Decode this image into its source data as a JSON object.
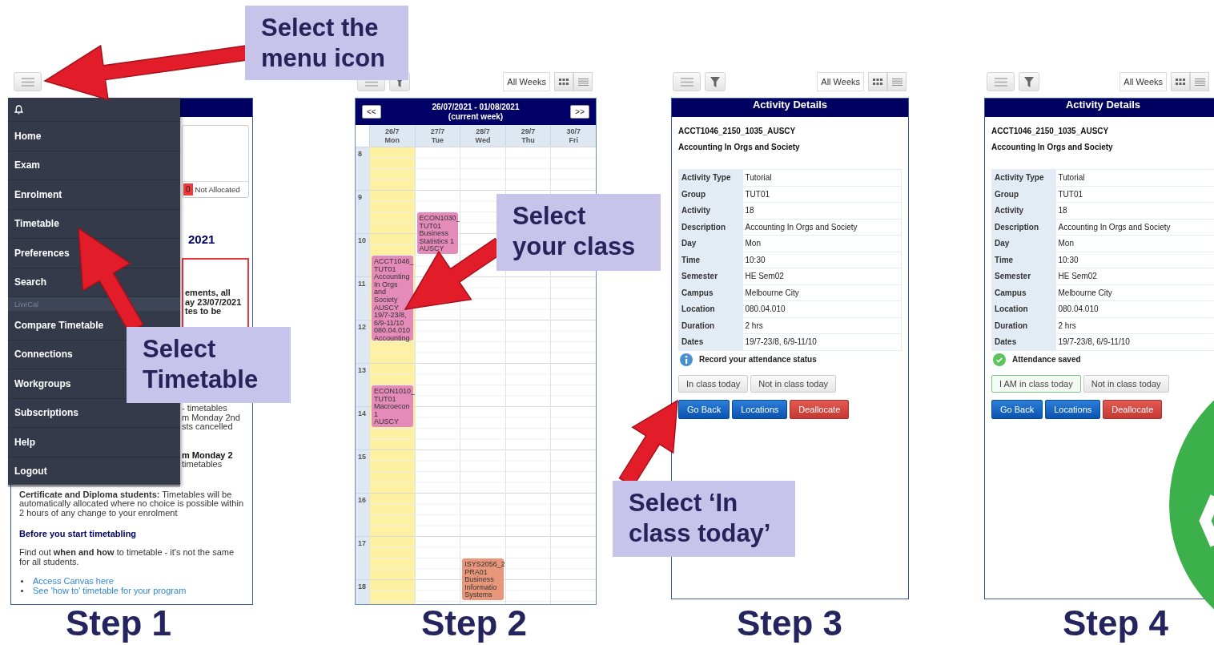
{
  "callouts": [
    {
      "text": "Select the\nmenu icon"
    },
    {
      "text": "Select\nTimetable"
    },
    {
      "text": "Select\nyour class"
    },
    {
      "text": "Select ‘In\nclass today’"
    }
  ],
  "step_labels": [
    "Step 1",
    "Step 2",
    "Step 3",
    "Step 4"
  ],
  "step_1": {
    "menu": [
      {
        "kind": "bell"
      },
      {
        "kind": "item",
        "label": "Home"
      },
      {
        "kind": "item",
        "label": "Exam"
      },
      {
        "kind": "item",
        "label": "Enrolment"
      },
      {
        "kind": "item",
        "label": "Timetable"
      },
      {
        "kind": "item",
        "label": "Preferences"
      },
      {
        "kind": "item",
        "label": "Search"
      },
      {
        "kind": "section",
        "label": "LiveCal"
      },
      {
        "kind": "item",
        "label": "Compare Timetable"
      },
      {
        "kind": "item",
        "label": "Connections"
      },
      {
        "kind": "item",
        "label": "Workgroups"
      },
      {
        "kind": "item",
        "label": "Subscriptions"
      },
      {
        "kind": "item",
        "label": "Help"
      },
      {
        "kind": "item",
        "label": "Logout"
      }
    ],
    "enrolment_card": {
      "badge": "0",
      "label": "Not Allocated"
    },
    "heading_fragment": "2021",
    "notice_fragments": [
      "ements, all",
      "ay 23/07/2021",
      "tes to be"
    ],
    "text_fragments": [
      {
        "bold": false,
        "lines": [
          "- timetables",
          "m Monday 2nd",
          "sts cancelled"
        ]
      },
      {
        "bold": true,
        "lines": [
          "m Monday 2"
        ]
      },
      {
        "bold": false,
        "lines": [
          "timetables"
        ]
      }
    ],
    "certificate_note": "**Certificate and Diploma students:** Timetables will be automatically allocated where no choice is possible within 2 hours of any change to your enrolment",
    "section_heading": "Before you start timetabling",
    "intro": "Find out **when and how** to timetable - it's not the same for all students.",
    "links": [
      "Access Canvas here",
      "See 'how to' timetable for your program"
    ]
  },
  "step_2": {
    "toolbar": {
      "all_weeks": "All Weeks"
    },
    "calendar": {
      "prev": "<<",
      "next": ">>",
      "range": "26/07/2021 - 01/08/2021",
      "note": "(current week)",
      "hours": [
        "8",
        "9",
        "10",
        "11",
        "12",
        "13",
        "14",
        "15",
        "16",
        "17",
        "18"
      ],
      "days": [
        {
          "date": "26/7",
          "day": "Mon",
          "selected": true,
          "events": [
            {
              "color": "#e58bb9",
              "text": "ACCT1046_\nTUT01\nAccounting\nIn Orgs\nand\nSociety\nAUSCY\n19/7-23/8,\n6/9-11/10\n080.04.010\nAccounting"
            },
            {
              "color": "#e58bb9",
              "text": "ECON1010_\nTUT01\nMacroecon\n1\nAUSCY"
            }
          ]
        },
        {
          "date": "27/7",
          "day": "Tue",
          "selected": false,
          "events": [
            {
              "color": "#e58bb9",
              "text": "ECON1030_\nTUT01\nBusiness\nStatistics 1\nAUSCY"
            }
          ]
        },
        {
          "date": "28/7",
          "day": "Wed",
          "selected": false,
          "events": [
            {
              "color": "#e8977a",
              "text": "ISYS2056_2\nPRA01\nBusiness\nInformatio\nSystems"
            }
          ]
        },
        {
          "date": "29/7",
          "day": "Thu",
          "selected": false
        },
        {
          "date": "30/7",
          "day": "Fri",
          "selected": false
        }
      ]
    }
  },
  "step_3": {
    "toolbar": {
      "all_weeks": "All Weeks"
    },
    "title": "Activity Details",
    "code": "ACCT1046_2150_1035_AUSCY",
    "name": "Accounting In Orgs and Society",
    "rows": [
      {
        "label": "Activity Type",
        "value": "Tutorial"
      },
      {
        "label": "Group",
        "value": "TUT01"
      },
      {
        "label": "Activity",
        "value": "18"
      },
      {
        "label": "Description",
        "value": "Accounting In Orgs and Society"
      },
      {
        "label": "Day",
        "value": "Mon"
      },
      {
        "label": "Time",
        "value": "10:30"
      },
      {
        "label": "Semester",
        "value": "HE Sem02"
      },
      {
        "label": "Campus",
        "value": "Melbourne City"
      },
      {
        "label": "Location",
        "value": "080.04.010"
      },
      {
        "label": "Duration",
        "value": "2 hrs"
      },
      {
        "label": "Dates",
        "value": "19/7-23/8, 6/9-11/10"
      }
    ],
    "status": {
      "kind": "info",
      "text": "Record your attendance status"
    },
    "attendance_buttons": [
      {
        "label": "In class today",
        "selected": false
      },
      {
        "label": "Not in class today",
        "selected": false
      }
    ],
    "actions": [
      {
        "label": "Go Back",
        "kind": "primary"
      },
      {
        "label": "Locations",
        "kind": "primary"
      },
      {
        "label": "Deallocate",
        "kind": "danger"
      }
    ]
  },
  "step_4": {
    "toolbar": {
      "all_weeks": "All Weeks"
    },
    "title": "Activity Details",
    "code": "ACCT1046_2150_1035_AUSCY",
    "name": "Accounting In Orgs and Society",
    "rows": [
      {
        "label": "Activity Type",
        "value": "Tutorial"
      },
      {
        "label": "Group",
        "value": "TUT01"
      },
      {
        "label": "Activity",
        "value": "18"
      },
      {
        "label": "Description",
        "value": "Accounting In Orgs and Society"
      },
      {
        "label": "Day",
        "value": "Mon"
      },
      {
        "label": "Time",
        "value": "10:30"
      },
      {
        "label": "Semester",
        "value": "HE Sem02"
      },
      {
        "label": "Campus",
        "value": "Melbourne City"
      },
      {
        "label": "Location",
        "value": "080.04.010"
      },
      {
        "label": "Duration",
        "value": "2 hrs"
      },
      {
        "label": "Dates",
        "value": "19/7-23/8, 6/9-11/10"
      }
    ],
    "status": {
      "kind": "saved",
      "text": "Attendance saved"
    },
    "attendance_buttons": [
      {
        "label": "I AM in class today",
        "selected": true
      },
      {
        "label": "Not in class today",
        "selected": false
      }
    ],
    "actions": [
      {
        "label": "Go Back",
        "kind": "primary"
      },
      {
        "label": "Locations",
        "kind": "primary"
      },
      {
        "label": "Deallocate",
        "kind": "danger"
      }
    ]
  }
}
